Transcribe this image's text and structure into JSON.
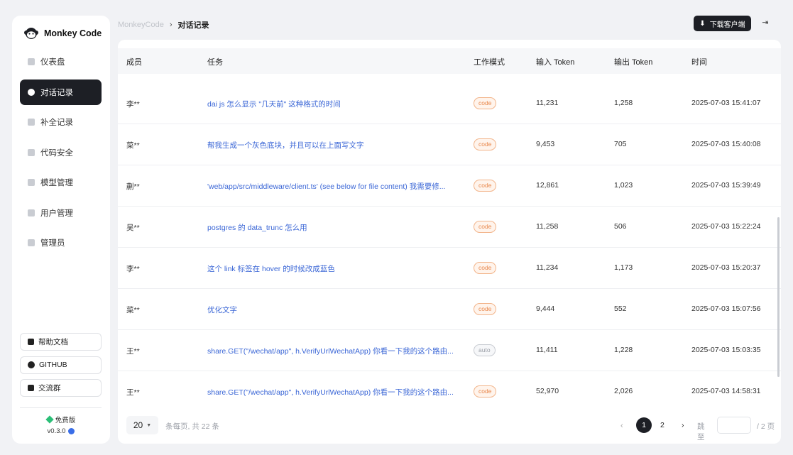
{
  "app": {
    "name": "Monkey Code"
  },
  "sidebar": {
    "items": [
      {
        "label": "仪表盘"
      },
      {
        "label": "对话记录"
      },
      {
        "label": "补全记录"
      },
      {
        "label": "代码安全"
      },
      {
        "label": "模型管理"
      },
      {
        "label": "用户管理"
      },
      {
        "label": "管理员"
      }
    ],
    "buttons": [
      {
        "label": "帮助文档"
      },
      {
        "label": "GITHUB"
      },
      {
        "label": "交流群"
      }
    ],
    "plan": "免费版",
    "version": "v0.3.0"
  },
  "header": {
    "breadcrumb_home": "MonkeyCode",
    "breadcrumb_sep": "›",
    "breadcrumb_current": "对话记录",
    "download_label": "下载客户端"
  },
  "table": {
    "columns": [
      "成员",
      "任务",
      "工作模式",
      "输入 Token",
      "输出 Token",
      "时间"
    ],
    "rows": [
      {
        "member": "李**",
        "task": "dai js 怎么显示 \"几天前\" 这种格式的时间",
        "mode": "code",
        "in": "11,231",
        "out": "1,258",
        "time": "2025-07-03 15:41:07"
      },
      {
        "member": "菜**",
        "task": "帮我生成一个灰色底块，并且可以在上面写文字",
        "mode": "code",
        "in": "9,453",
        "out": "705",
        "time": "2025-07-03 15:40:08"
      },
      {
        "member": "蒯**",
        "task": "'web/app/src/middleware/client.ts' (see below for file content) 我需要修...",
        "mode": "code",
        "in": "12,861",
        "out": "1,023",
        "time": "2025-07-03 15:39:49"
      },
      {
        "member": "吴**",
        "task": "postgres 的 data_trunc 怎么用",
        "mode": "code",
        "in": "11,258",
        "out": "506",
        "time": "2025-07-03 15:22:24"
      },
      {
        "member": "李**",
        "task": "这个 link 标签在 hover 的时候改成蓝色",
        "mode": "code",
        "in": "11,234",
        "out": "1,173",
        "time": "2025-07-03 15:20:37"
      },
      {
        "member": "菜**",
        "task": "优化文字",
        "mode": "code",
        "in": "9,444",
        "out": "552",
        "time": "2025-07-03 15:07:56"
      },
      {
        "member": "王**",
        "task": "share.GET(\"/wechat/app\", h.VerifyUrlWechatApp) 你看一下我的这个路由...",
        "mode": "auto",
        "in": "11,411",
        "out": "1,228",
        "time": "2025-07-03 15:03:35"
      },
      {
        "member": "王**",
        "task": "share.GET(\"/wechat/app\", h.VerifyUrlWechatApp) 你看一下我的这个路由...",
        "mode": "code",
        "in": "52,970",
        "out": "2,026",
        "time": "2025-07-03 14:58:31"
      }
    ]
  },
  "pagination": {
    "page_size": "20",
    "total_text": "条每页, 共 22 条",
    "prev": "‹",
    "next": "›",
    "page1": "1",
    "page2": "2",
    "jump_label": "跳至",
    "jump_value": "",
    "jump_suffix": "/ 2 页"
  }
}
